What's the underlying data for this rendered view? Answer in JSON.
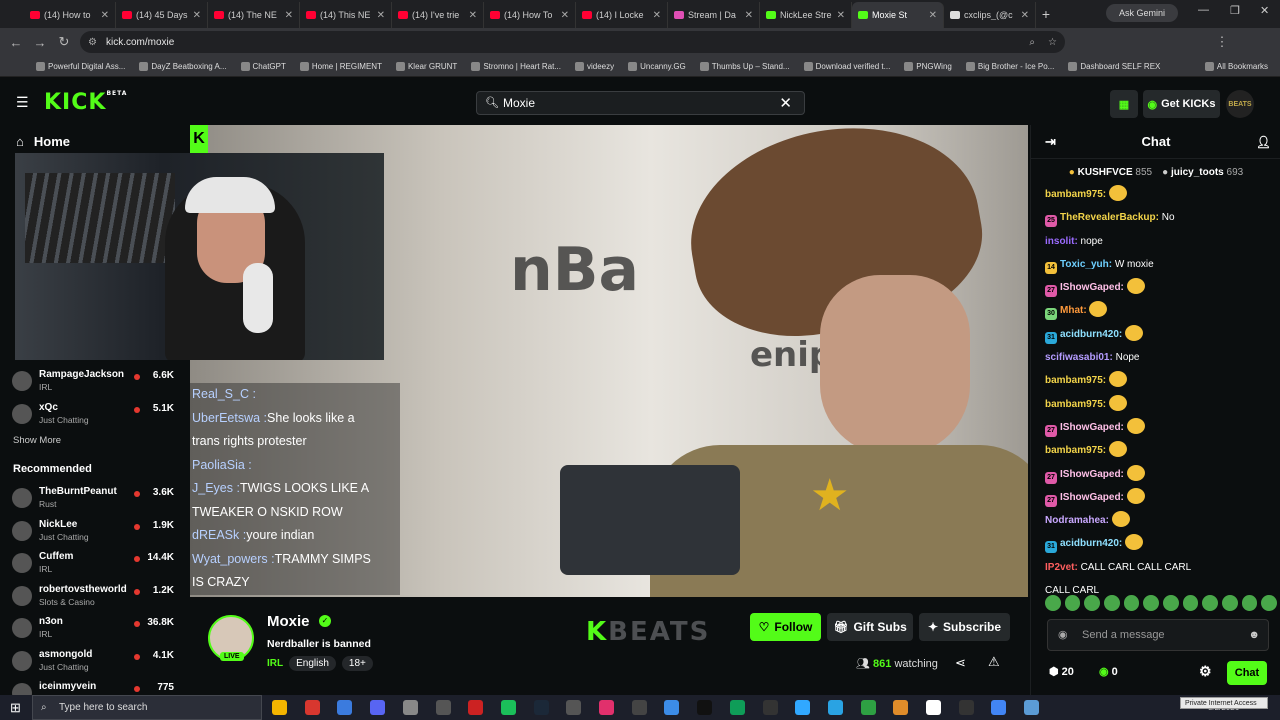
{
  "browser": {
    "tabs": [
      {
        "label": "(14) How to"
      },
      {
        "label": "(14) 45 Days"
      },
      {
        "label": "(14) The NE"
      },
      {
        "label": "(14) This NE"
      },
      {
        "label": "(14) I've trie"
      },
      {
        "label": "(14) How To"
      },
      {
        "label": "(14) I Locke"
      },
      {
        "label": "Stream | Da"
      },
      {
        "label": "NickLee Stre"
      },
      {
        "label": "Moxie St"
      },
      {
        "label": "cxclips_(@c"
      }
    ],
    "ask_gemini": "Ask Gemini",
    "url": "kick.com/moxie",
    "bookmarks": [
      "Powerful Digital Ass...",
      "DayZ Beatboxing A...",
      "ChatGPT",
      "Home | REGIMENT",
      "Klear GRUNT",
      "Stromno | Heart Rat...",
      "videezy",
      "Uncanny.GG",
      "Thumbs Up – Stand...",
      "Download verified t...",
      "PNGWing",
      "Big Brother - Ice Po...",
      "Dashboard SELF REX"
    ],
    "all_bookmarks": "All Bookmarks"
  },
  "header": {
    "logo": "KICK",
    "beta": "BETA",
    "search_value": "Moxie",
    "get_kicks": "Get KICKs",
    "beats": "BEATS"
  },
  "sidebar": {
    "home": "Home",
    "following": [
      {
        "name": "RampageJackson",
        "category": "IRL",
        "viewers": "6.6K"
      },
      {
        "name": "xQc",
        "category": "Just Chatting",
        "viewers": "5.1K"
      }
    ],
    "show_more": "Show More",
    "recommended_title": "Recommended",
    "recommended": [
      {
        "name": "TheBurntPeanut",
        "category": "Rust",
        "viewers": "3.6K"
      },
      {
        "name": "NickLee",
        "category": "Just Chatting",
        "viewers": "1.9K"
      },
      {
        "name": "Cuffem",
        "category": "IRL",
        "viewers": "14.4K"
      },
      {
        "name": "robertovstheworld",
        "category": "Slots & Casino",
        "viewers": "1.2K"
      },
      {
        "name": "n3on",
        "category": "IRL",
        "viewers": "36.8K"
      },
      {
        "name": "asmongold",
        "category": "Just Chatting",
        "viewers": "4.1K"
      },
      {
        "name": "iceinmyvein",
        "category": "",
        "viewers": "775"
      }
    ]
  },
  "video": {
    "overlay_chat": [
      {
        "user": "Real_S_C :",
        "text": ""
      },
      {
        "user": "UberEetswa :",
        "text": "She looks like a"
      },
      {
        "user": "",
        "text": "trans rights protester"
      },
      {
        "user": "PaoliaSia :",
        "text": ""
      },
      {
        "user": "J_Eyes :",
        "text": "TWIGS LOOKS LIKE A"
      },
      {
        "user": "",
        "text": "TWEAKER O NSKID ROW"
      },
      {
        "user": "dREASk :",
        "text": "youre indian"
      },
      {
        "user": "Wyat_powers :",
        "text": "TRAMMY SIMPS"
      },
      {
        "user": "",
        "text": "IS CRAZY"
      }
    ]
  },
  "channel": {
    "name": "Moxie",
    "live": "LIVE",
    "stream_title": "Nerdballer is banned",
    "category": "IRL",
    "tags": [
      "English",
      "18+"
    ],
    "sponsor": "BEATS",
    "follow": "Follow",
    "gift_subs": "Gift Subs",
    "subscribe": "Subscribe",
    "viewers": "861",
    "watching": "watching"
  },
  "chat": {
    "title": "Chat",
    "pinned": [
      {
        "name": "KUSHFVCE",
        "count": "855"
      },
      {
        "name": "juicy_toots",
        "count": "693"
      }
    ],
    "messages": [
      {
        "badge": "",
        "user": "bambam975:",
        "user_color": "#f3d44a",
        "text": ""
      },
      {
        "badge": "25",
        "user": "TheRevealerBackup:",
        "user_color": "#f3d44a",
        "text": " No"
      },
      {
        "badge": "",
        "user": "insolit:",
        "user_color": "#9b6bff",
        "text": " nope"
      },
      {
        "badge": "14",
        "user": "Toxic_yuh:",
        "user_color": "#6ed0ff",
        "text": " W moxie"
      },
      {
        "badge": "27",
        "user": "IShowGaped:",
        "user_color": "#ffc0e8",
        "text": ""
      },
      {
        "badge": "30",
        "user": "Mhat:",
        "user_color": "#ff9a3c",
        "text": ""
      },
      {
        "badge": "31",
        "user": "acidburn420:",
        "user_color": "#8fe0ff",
        "text": ""
      },
      {
        "badge": "",
        "user": "scifiwasabi01:",
        "user_color": "#b59cff",
        "text": " Nope"
      },
      {
        "badge": "",
        "user": "bambam975:",
        "user_color": "#f3d44a",
        "text": ""
      },
      {
        "badge": "",
        "user": "bambam975:",
        "user_color": "#f3d44a",
        "text": ""
      },
      {
        "badge": "27",
        "user": "IShowGaped:",
        "user_color": "#ffc0e8",
        "text": ""
      },
      {
        "badge": "",
        "user": "bambam975:",
        "user_color": "#f3d44a",
        "text": ""
      },
      {
        "badge": "27",
        "user": "IShowGaped:",
        "user_color": "#ffc0e8",
        "text": ""
      },
      {
        "badge": "27",
        "user": "IShowGaped:",
        "user_color": "#ffc0e8",
        "text": ""
      },
      {
        "badge": "",
        "user": "Nodramahea:",
        "user_color": "#c9a8ff",
        "text": ""
      },
      {
        "badge": "31",
        "user": "acidburn420:",
        "user_color": "#8fe0ff",
        "text": ""
      },
      {
        "badge": "",
        "user": "IP2vet:",
        "user_color": "#ff5f5f",
        "text": " CALL CARL  CALL CARL"
      },
      {
        "badge": "",
        "user": "",
        "user_color": "#ffffff",
        "text": "CALL CARL"
      }
    ],
    "placeholder": "Send a message",
    "points": "20",
    "kicks": "0",
    "chat_button": "Chat"
  },
  "taskbar": {
    "search_placeholder": "Type here to search",
    "tray_label": "Private Internet Access",
    "date": "8/2/2026"
  },
  "colors": {
    "accent": "#53fc18",
    "background": "#0b0e0f"
  }
}
